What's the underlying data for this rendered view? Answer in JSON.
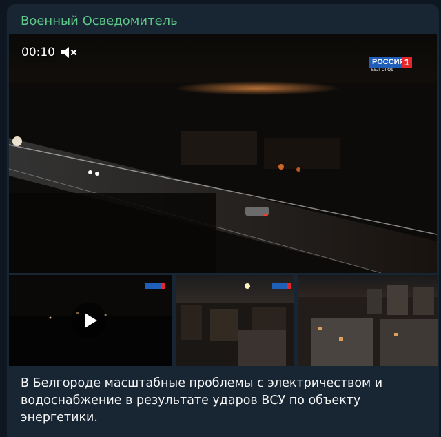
{
  "post": {
    "channel_name": "Военный Осведомитель",
    "video": {
      "timecode": "00:10",
      "mute_icon": "muted-speaker-icon",
      "broadcaster_logo": {
        "name": "РОССИЯ",
        "number": "1",
        "city": "БЕЛГОРОД"
      }
    },
    "thumbnails": [
      {
        "kind": "video",
        "icon": "play-icon"
      },
      {
        "kind": "photo"
      },
      {
        "kind": "photo"
      }
    ],
    "text": "В Белгороде масштабные проблемы с электричеством и\nводоснабжение в результате ударов ВСУ по объекту\nэнергетики."
  },
  "colors": {
    "background": "#0e1621",
    "bubble": "#182533",
    "channel_name": "#5dc887",
    "text": "#f5f5f5"
  }
}
